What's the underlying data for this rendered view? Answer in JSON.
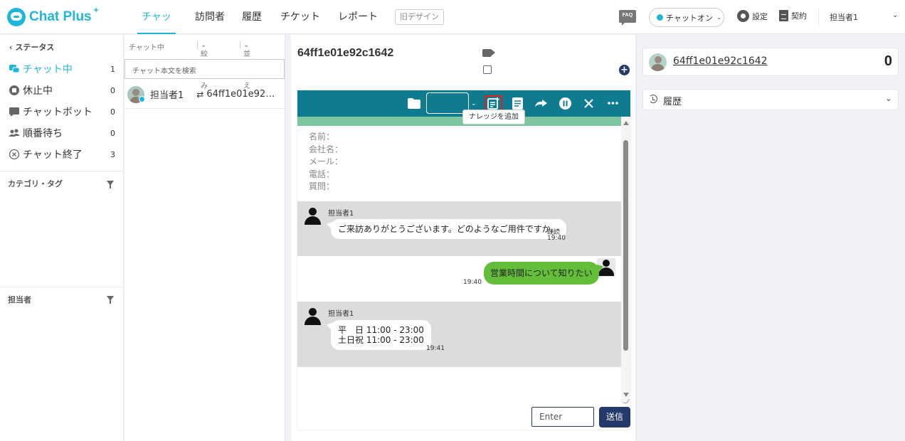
{
  "header": {
    "logo_text": "Chat Plus",
    "logo_plus": "+",
    "tabs": [
      {
        "label": "チャット",
        "active": true
      },
      {
        "label": "訪問者"
      },
      {
        "label": "履歴"
      },
      {
        "label": "チケット"
      },
      {
        "label": "レポート"
      }
    ],
    "old_design": "旧デザイン",
    "faq": "FAQ",
    "chat_status": "チャットオン",
    "settings": "設定",
    "contract": "契約",
    "user": "担当者1",
    "accent_color": "#1fb6d9"
  },
  "sidebar": {
    "status_title": "ステータス",
    "items": [
      {
        "label": "チャット中",
        "count": "1",
        "icon": "chat-bubbles-icon"
      },
      {
        "label": "休止中",
        "count": "0",
        "icon": "stop-circle-icon"
      },
      {
        "label": "チャットボット",
        "count": "0",
        "icon": "bot-chat-icon"
      },
      {
        "label": "順番待ち",
        "count": "0",
        "icon": "people-icon"
      },
      {
        "label": "チャット終了",
        "count": "3",
        "icon": "close-circle-icon"
      }
    ],
    "category_title": "カテゴリ・タグ",
    "assignee_title": "担当者"
  },
  "chatlist": {
    "header_label": "チャット中",
    "filter_label": "絞り込み",
    "sort_label": "並び替え",
    "search_placeholder": "チャット本文を検索",
    "rows": [
      {
        "assignee": "担当者1",
        "arrow": "⇄",
        "visitor_id": "64ff1e01e92…"
      }
    ]
  },
  "conversation": {
    "title": "64ff1e01e92c1642",
    "tooltip": "ナレッジを追加",
    "form_fields": [
      "名前：",
      "会社名：",
      "メール：",
      "電話：",
      "質問："
    ],
    "messages": [
      {
        "from": "operator",
        "name": "担当者1",
        "text": "ご来訪ありがとうございます。どのようなご用件ですか。",
        "read": "既読",
        "time": "19:40"
      },
      {
        "from": "visitor",
        "text": "営業時間について知りたい",
        "time": "19:40"
      },
      {
        "from": "operator",
        "name": "担当者1",
        "lines": [
          "平　日 11:00 - 23:00",
          "土日祝 11:00 - 23:00"
        ],
        "time": "19:41"
      }
    ],
    "input_placeholder": "Enter",
    "send_label": "送信",
    "toolbar_color": "#0e7b8f",
    "send_color": "#243a6b"
  },
  "right_panel": {
    "visitor_id": "64ff1e01e92c1642",
    "count": "0",
    "history_label": "履歴"
  }
}
